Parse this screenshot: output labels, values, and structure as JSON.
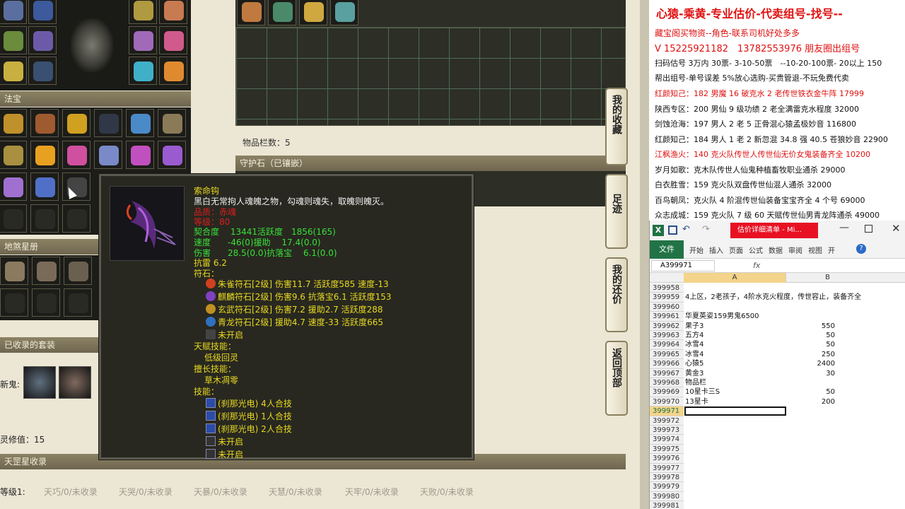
{
  "game": {
    "section_fabao": "法宝",
    "section_disha": "地煞星册",
    "section_sets": "已收录的套装",
    "sets_new_label": "新鬼:",
    "ling_value": "灵修值：15",
    "section_tiangang": "天罡星收录",
    "level1_label": "等级1:",
    "tiangang_items": [
      "天巧/0/未收录",
      "天哭/0/未收录",
      "天暴/0/未收录",
      "天慧/0/未收录",
      "天牢/0/未收录",
      "天败/0/未收录"
    ],
    "item_count": "物品栏数：5",
    "guard_stone": "守护石（已镶嵌）",
    "side_buttons": [
      "我的收藏",
      "足迹",
      "我的还价",
      "返回顶部"
    ]
  },
  "tooltip": {
    "name": "索命钩",
    "desc": "黑白无常拘人魂魄之物，勾魂则魂失，取魄则魄灭。",
    "quality": "品质：赤魂",
    "level": "等级：80",
    "stats": [
      "契合度　 13441活跃度　1856(165)",
      "速度　　-46(0)援助　  17.4(0.0)",
      "伤害　　28.5(0.0)抗落宝　 6.1(0.0)",
      "抗雷 6.2"
    ],
    "runes_label": "符石：",
    "runes": [
      {
        "text": "朱雀符石[2级] 伤害11.7 活跃度585 速度-13",
        "color": "#d04020"
      },
      {
        "text": "麒麟符石[2级] 伤害9.6 抗落宝6.1 活跃度153",
        "color": "#8040c0"
      },
      {
        "text": "玄武符石[2级] 伤害7.2 援助2.7 活跃度288",
        "color": "#c09020"
      },
      {
        "text": "青龙符石[2级] 援助4.7 速度-33 活跃度665",
        "color": "#3070c0"
      },
      {
        "text": "未开启",
        "color": "#444"
      }
    ],
    "talent_label": "天赋技能：",
    "talent": "低级回灵",
    "expert_label": "擅长技能：",
    "expert": "草木凋零",
    "skill_label": "技能：",
    "skills": [
      "(刹那光电) 4人合技",
      "(刹那光电) 1人合技",
      "(刹那光电) 2人合技",
      "未开启",
      "未开启"
    ]
  },
  "notes": {
    "title": "心猿-乘黄-专业估价-代卖组号-找号--",
    "lines": [
      {
        "t": "藏宝阁买物资--角色-联系司机好处多多",
        "c": "#e01010"
      },
      {
        "t": "V 15225921182　13782553976 朋友圈出组号",
        "c": "#e01010"
      },
      {
        "t": "扫码估号 3万内 30票- 3-10-50票　--10-20-100票- 20以上 150",
        "c": "#111"
      },
      {
        "t": "帮出组号-单号误差 5%放心选购-买贵管退-不玩免费代卖",
        "c": "#111"
      },
      {
        "t": "红颜知己：182 男魔 16 破克水 2 老传世铁衣金牛阵 17999",
        "c": "#e01010"
      },
      {
        "t": "陕西专区：200 男仙 9 级功绩 2 老全满雷克水程度 32000",
        "c": "#111"
      },
      {
        "t": "剑蚀沧海：197 男人 2 老 5 正骨混心猿孟极妙音 116800",
        "c": "#111"
      },
      {
        "t": "红颜知己：184 男人 1 老 2 新忽混 34.8 强 40.5 苍狼妙音 22900",
        "c": "#111"
      },
      {
        "t": "江枫渔火：140 克火队传世人传世仙无价女鬼装备齐全 10200",
        "c": "#e01010"
      },
      {
        "t": "岁月如歌：克木队传世人仙鬼种植畜牧职业通杀 29000",
        "c": "#111"
      },
      {
        "t": "白衣胜雪：159 克火队双盘传世仙混人通杀 32000",
        "c": "#111"
      },
      {
        "t": "百鸟朝凤：克火队 4 阶混传世仙装备宝宝齐全 4 个号 69000",
        "c": "#111"
      },
      {
        "t": "众志成城：159 克火队 7 级 60 天赋传世仙男青龙阵通杀 49000",
        "c": "#111"
      }
    ]
  },
  "excel": {
    "title": "估价详细清单 - Mi...",
    "tabs": [
      "文件",
      "开始",
      "插入",
      "页面",
      "公式",
      "数据",
      "审阅",
      "视图",
      "开"
    ],
    "name_box": "A399971",
    "fx": "fx",
    "col_a": "A",
    "col_b": "B",
    "rows": [
      {
        "n": "399958",
        "a": "",
        "b": ""
      },
      {
        "n": "399959",
        "a": "4上区，2老孩子，4阶水克火程度，传世容止，装备齐全",
        "b": ""
      },
      {
        "n": "399960",
        "a": "",
        "b": ""
      },
      {
        "n": "399961",
        "a": "华夏英姿159男鬼6500",
        "b": ""
      },
      {
        "n": "399962",
        "a": "果子3",
        "b": "550"
      },
      {
        "n": "399963",
        "a": "五方4",
        "b": "50"
      },
      {
        "n": "399964",
        "a": "冰雪4",
        "b": "50"
      },
      {
        "n": "399965",
        "a": "冰雪4",
        "b": "250"
      },
      {
        "n": "399966",
        "a": "心猿5",
        "b": "2400"
      },
      {
        "n": "399967",
        "a": "黄金3",
        "b": "30"
      },
      {
        "n": "399968",
        "a": "物品栏",
        "b": ""
      },
      {
        "n": "399969",
        "a": "10星卡三S",
        "b": "50"
      },
      {
        "n": "399970",
        "a": "13星卡",
        "b": "200"
      },
      {
        "n": "399971",
        "a": "",
        "b": ""
      },
      {
        "n": "399972",
        "a": "",
        "b": ""
      },
      {
        "n": "399973",
        "a": "",
        "b": ""
      },
      {
        "n": "399974",
        "a": "",
        "b": ""
      },
      {
        "n": "399975",
        "a": "",
        "b": ""
      },
      {
        "n": "399976",
        "a": "",
        "b": ""
      },
      {
        "n": "399977",
        "a": "",
        "b": ""
      },
      {
        "n": "399978",
        "a": "",
        "b": ""
      },
      {
        "n": "399979",
        "a": "",
        "b": ""
      },
      {
        "n": "399980",
        "a": "",
        "b": ""
      },
      {
        "n": "399981",
        "a": "",
        "b": ""
      }
    ]
  }
}
